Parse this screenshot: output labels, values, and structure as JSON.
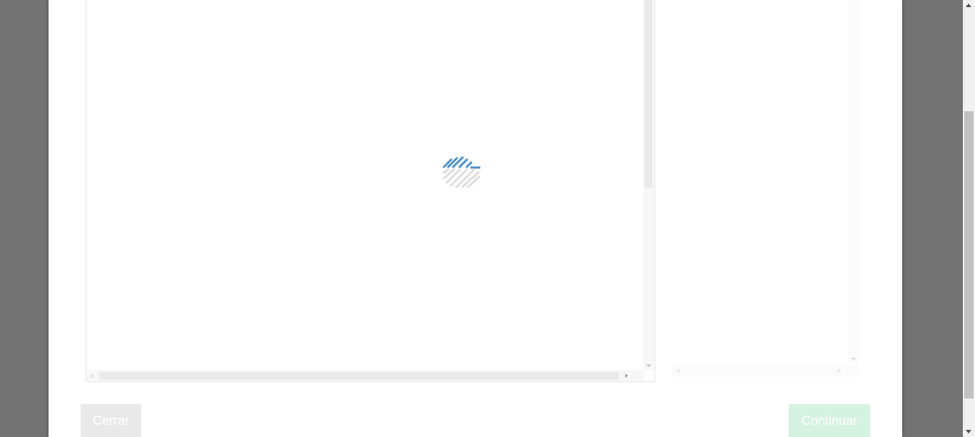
{
  "dialog": {
    "close_label": "Cerrar",
    "continue_label": "Continuar"
  },
  "loader": {
    "icon": "loading-spinner-icon",
    "accent_color": "#4a90d0",
    "muted_color": "#dddddd"
  },
  "colors": {
    "overlay": "#737373",
    "close_button_bg": "#e9e9e9",
    "continue_button_bg": "#d6f2e1"
  }
}
